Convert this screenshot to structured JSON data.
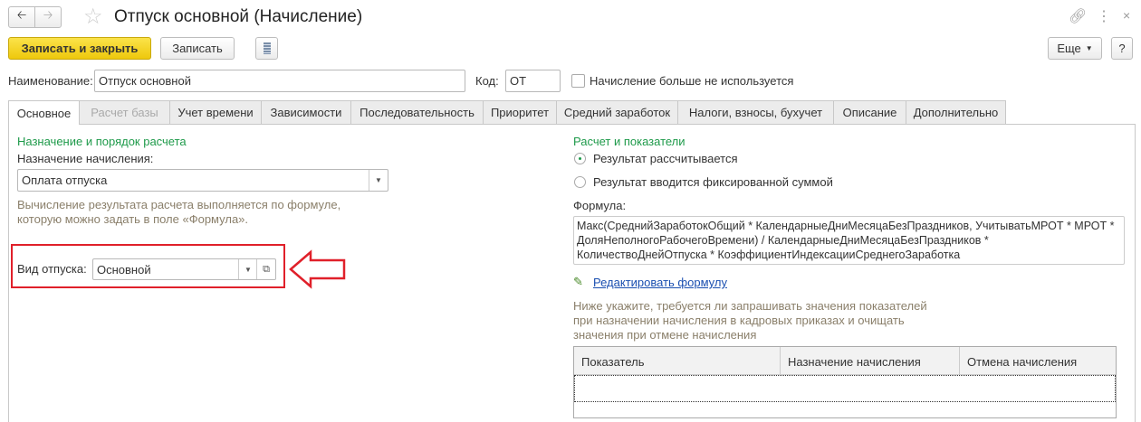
{
  "window": {
    "title": "Отпуск основной (Начисление)"
  },
  "toolbar": {
    "save_close": "Записать и закрыть",
    "save": "Записать",
    "more": "Еще",
    "help": "?"
  },
  "header": {
    "name_label": "Наименование:",
    "name_value": "Отпуск основной",
    "code_label": "Код:",
    "code_value": "ОТ",
    "unused_label": "Начисление больше не используется",
    "unused_checked": false
  },
  "tabs": [
    {
      "label": "Основное"
    },
    {
      "label": "Расчет базы"
    },
    {
      "label": "Учет времени"
    },
    {
      "label": "Зависимости"
    },
    {
      "label": "Последовательность"
    },
    {
      "label": "Приоритет"
    },
    {
      "label": "Средний заработок"
    },
    {
      "label": "Налоги, взносы, бухучет"
    },
    {
      "label": "Описание"
    },
    {
      "label": "Дополнительно"
    }
  ],
  "left": {
    "heading": "Назначение и порядок расчета",
    "purpose_label": "Назначение начисления:",
    "purpose_value": "Оплата отпуска",
    "hint": "Вычисление результата расчета выполняется по формуле, которую можно задать в поле «Формула».",
    "vacation_label": "Вид отпуска:",
    "vacation_value": "Основной"
  },
  "right": {
    "heading": "Расчет и показатели",
    "radio1": "Результат рассчитывается",
    "radio2": "Результат вводится фиксированной суммой",
    "selected": 1,
    "formula_label": "Формула:",
    "formula": "Макс(СреднийЗаработокОбщий * КалендарныеДниМесяцаБезПраздников, УчитыватьМРОТ * МРОТ * ДоляНеполногоРабочегоВремени) / КалендарныеДниМесяцаБезПраздников * КоличествоДнейОтпуска * КоэффициентИндексацииСреднегоЗаработка",
    "edit_link": "Редактировать формулу",
    "hint": "Ниже укажите, требуется ли запрашивать значения показателей при назначении начисления в кадровых приказах и очищать значения при отмене начисления",
    "columns": [
      "Показатель",
      "Назначение начисления",
      "Отмена начисления"
    ]
  },
  "colors": {
    "accent": "#f5d21a",
    "green": "#1e9a4a",
    "annotation": "#e0202a",
    "link": "#1a4fb0"
  }
}
